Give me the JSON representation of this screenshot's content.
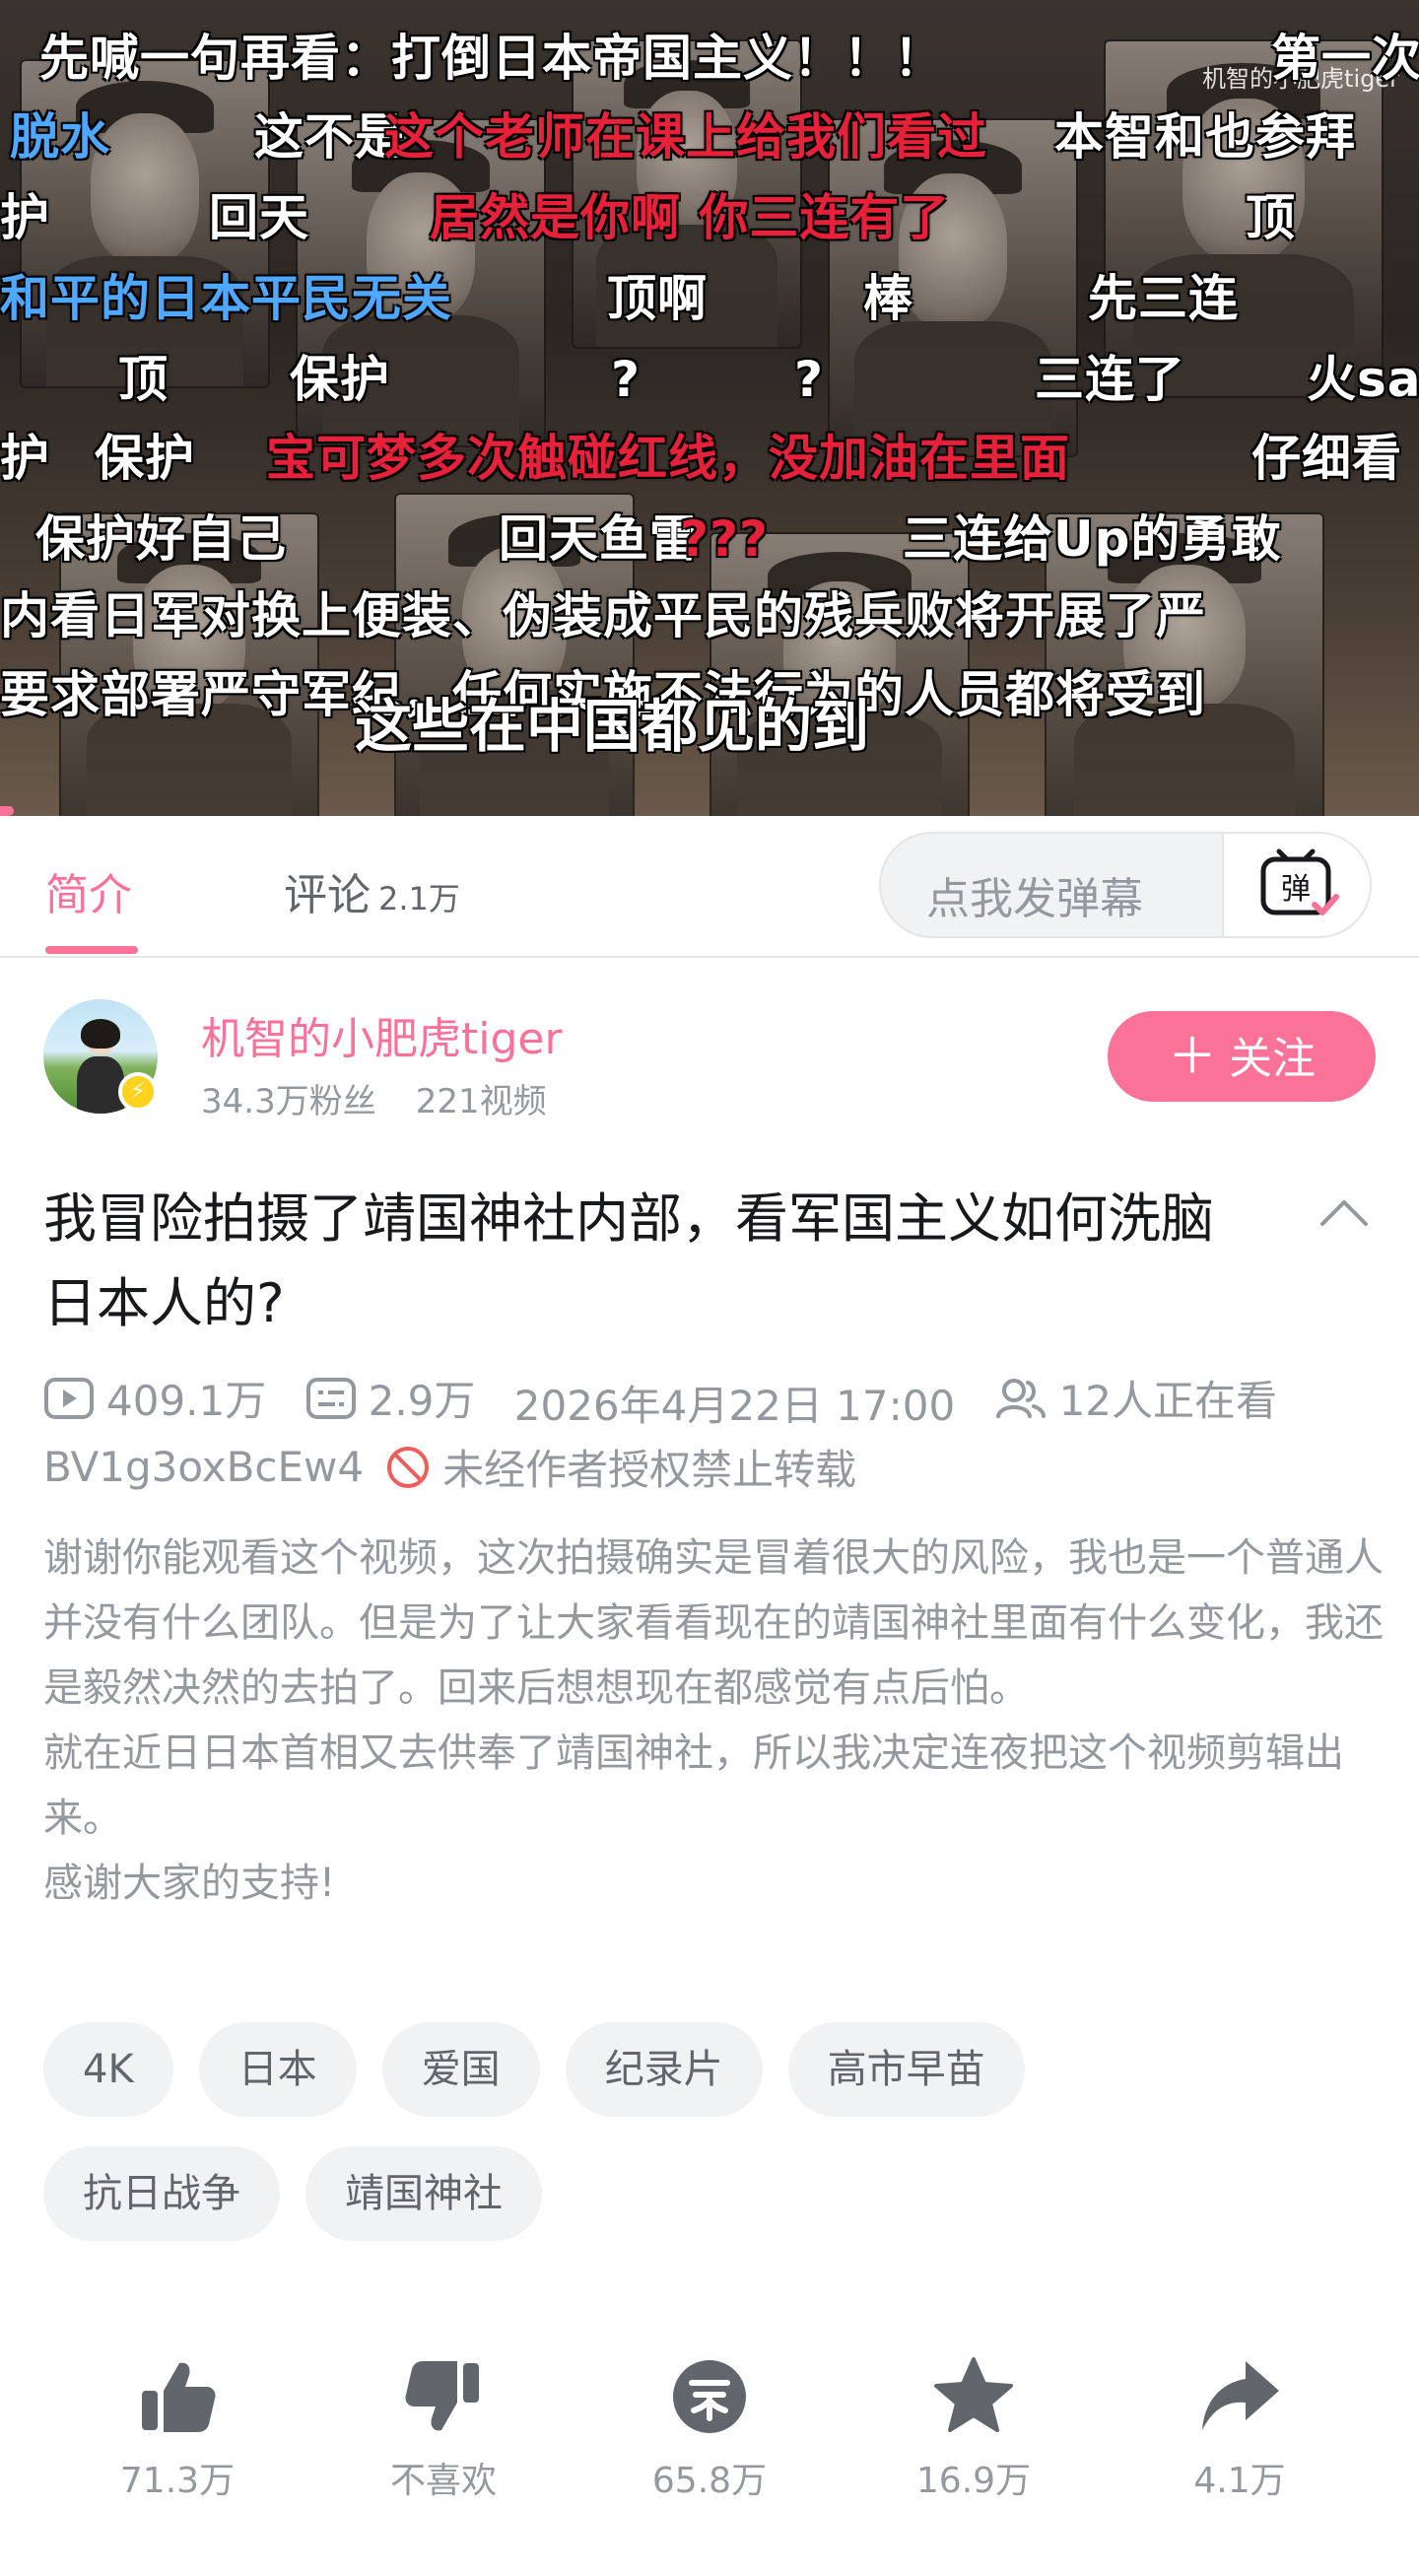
{
  "video": {
    "watermark": "机智的小肥虎tiger",
    "subtitle": "这些在中国都见的到",
    "danmaku": [
      {
        "text": "先喊一句再看：打倒日本帝国主义！！！",
        "color": "white"
      },
      {
        "text": "第一次",
        "color": "white"
      },
      {
        "text": "脱水",
        "color": "blue"
      },
      {
        "text": "这不是",
        "color": "white"
      },
      {
        "text": "这个老师在课上给我们看过",
        "color": "red"
      },
      {
        "text": "本智和也参拜",
        "color": "white"
      },
      {
        "text": "护",
        "color": "white"
      },
      {
        "text": "回天",
        "color": "white"
      },
      {
        "text": "居然是你啊 你三连有了",
        "color": "red"
      },
      {
        "text": "顶",
        "color": "white"
      },
      {
        "text": "和平的日本平民无关",
        "color": "blue"
      },
      {
        "text": "顶啊",
        "color": "white"
      },
      {
        "text": "棒",
        "color": "white"
      },
      {
        "text": "先三连",
        "color": "white"
      },
      {
        "text": "顶",
        "color": "white"
      },
      {
        "text": "保护",
        "color": "white"
      },
      {
        "text": "?",
        "color": "white"
      },
      {
        "text": "?",
        "color": "white"
      },
      {
        "text": "三连了",
        "color": "white"
      },
      {
        "text": "火sa",
        "color": "white"
      },
      {
        "text": "护",
        "color": "white"
      },
      {
        "text": "保护",
        "color": "white"
      },
      {
        "text": "宝可梦多次触碰红线，没加油在里面",
        "color": "red"
      },
      {
        "text": "仔细看",
        "color": "white"
      },
      {
        "text": "保护好自己",
        "color": "white"
      },
      {
        "text": "回天鱼雷",
        "color": "white"
      },
      {
        "text": "???",
        "color": "red"
      },
      {
        "text": "三连给Up的勇敢",
        "color": "white"
      },
      {
        "text": "内看日军对换上便装、伪装成平民的残兵败将开展了严",
        "color": "white"
      },
      {
        "text": "要求部署严守军纪，任何实施不法行为的人员都将受到",
        "color": "white"
      }
    ]
  },
  "tabs": [
    {
      "label": "简介",
      "count": ""
    },
    {
      "label": "评论",
      "count": "2.1万"
    }
  ],
  "danmaku_input": {
    "placeholder": "点我发弹幕",
    "toggle_label": "弹"
  },
  "uploader": {
    "name": "机智的小肥虎tiger",
    "fans": "34.3万粉丝",
    "videos": "221视频",
    "follow_label": "关注"
  },
  "title": "我冒险拍摄了靖国神社内部，看军国主义如何洗脑日本人的?",
  "meta": {
    "views": "409.1万",
    "danmaku_count": "2.9万",
    "date": "2026年4月22日 17:00",
    "watching": "12人正在看",
    "bvid": "BV1g3oxBcEw4",
    "notice": "未经作者授权禁止转载"
  },
  "description": [
    "谢谢你能观看这个视频，这次拍摄确实是冒着很大的风险，我也是一个普通人并没有什么团队。但是为了让大家看看现在的靖国神社里面有什么变化，我还是毅然决然的去拍了。回来后想想现在都感觉有点后怕。",
    "就在近日日本首相又去供奉了靖国神社，所以我决定连夜把这个视频剪辑出来。",
    "感谢大家的支持!"
  ],
  "tags": [
    "4K",
    "日本",
    "爱国",
    "纪录片",
    "高市早苗",
    "抗日战争",
    "靖国神社"
  ],
  "actions": {
    "like": "71.3万",
    "dislike": "不喜欢",
    "coin": "65.8万",
    "favorite": "16.9万",
    "share": "4.1万"
  },
  "colors": {
    "accent": "#fb7299",
    "text_primary": "#18191c",
    "text_secondary": "#9499a0",
    "icon_gray": "#61666d",
    "badge_yellow": "#ffd21e"
  }
}
